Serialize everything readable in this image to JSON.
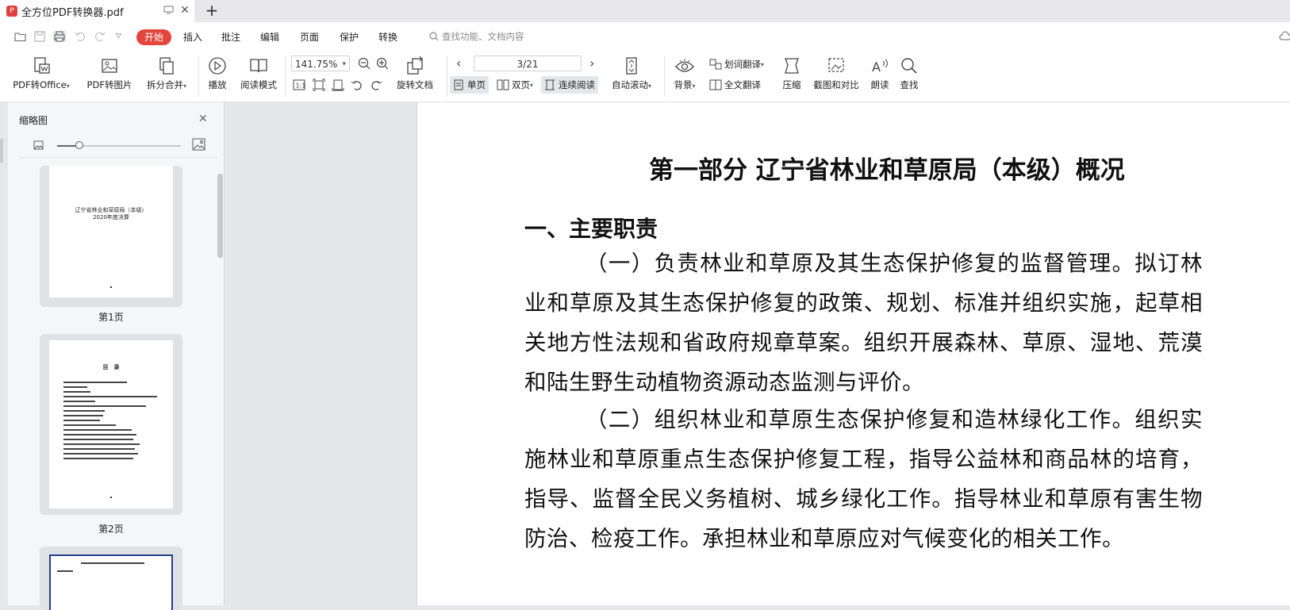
{
  "tab": {
    "title": "全方位PDF转换器.pdf",
    "badge": "P"
  },
  "menu": {
    "items": [
      "开始",
      "插入",
      "批注",
      "编辑",
      "页面",
      "保护",
      "转换"
    ],
    "search_placeholder": "查找功能、文档内容"
  },
  "toolbar": {
    "pdf_to_office": "PDF转Office",
    "pdf_to_image": "PDF转图片",
    "split_merge": "拆分合并",
    "play": "播放",
    "read_mode": "阅读模式",
    "zoom": "141.75%",
    "page_indicator": "3/21",
    "rotate_doc": "旋转文档",
    "single_page": "单页",
    "double_page": "双页",
    "continuous": "连续阅读",
    "auto_scroll": "自动滚动",
    "background": "背景",
    "word_translate": "划词翻译",
    "full_translate": "全文翻译",
    "compress": "压缩",
    "screenshot_compare": "截图和对比",
    "read_aloud": "朗读",
    "find": "查找"
  },
  "thumbnail_panel": {
    "title": "缩略图",
    "pages": [
      {
        "label": "第1页",
        "title_lines": [
          "辽宁省林业和草原局（本级）",
          "2020年度决算"
        ]
      },
      {
        "label": "第2页",
        "heading": "目　录"
      },
      {
        "label": ""
      }
    ]
  },
  "document": {
    "title": "第一部分  辽宁省林业和草原局（本级）概况",
    "section_heading": "一、主要职责",
    "paragraphs": [
      "（一）负责林业和草原及其生态保护修复的监督管理。拟订林业和草原及其生态保护修复的政策、规划、标准并组织实施，起草相关地方性法规和省政府规章草案。组织开展森林、草原、湿地、荒漠和陆生野生动植物资源动态监测与评价。",
      "（二）组织林业和草原生态保护修复和造林绿化工作。组织实施林业和草原重点生态保护修复工程，指导公益林和商品林的培育，指导、监督全民义务植树、城乡绿化工作。指导林业和草原有害生物防治、检疫工作。承担林业和草原应对气候变化的相关工作。"
    ]
  },
  "colors": {
    "accent": "#e2453c",
    "pdf_badge": "#e2403d"
  }
}
